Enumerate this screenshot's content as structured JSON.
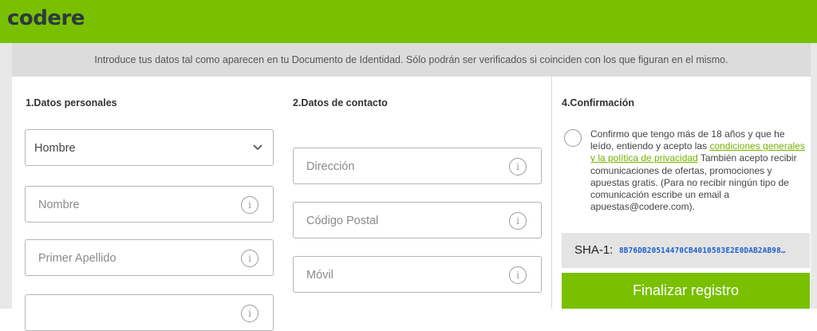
{
  "header": {
    "logo": "codere"
  },
  "notice": "Introduce tus datos tal como aparecen en tu Documento de Identidad. Sólo podrán ser verificados si coinciden con los que figuran en el mismo.",
  "sections": {
    "personal": {
      "title": "1.Datos personales",
      "gender_value": "Hombre",
      "nombre_placeholder": "Nombre",
      "apellido_placeholder": "Primer Apellido"
    },
    "contact": {
      "title": "2.Datos de contacto",
      "direccion_placeholder": "Dirección",
      "postal_placeholder": "Código Postal",
      "movil_placeholder": "Móvil"
    },
    "confirm": {
      "title": "4.Confirmación",
      "consent_before": "Confirmo que tengo más de 18 años y que he leído, entiendo y acepto las ",
      "consent_link": "condiciones generales y la política de privacidad",
      "consent_after": " También acepto recibir comunicaciones de ofertas, promociones y apuestas gratis. (Para no recibir ningún tipo de comunicación escribe un email a apuestas@codere.com).",
      "sha_label": "SHA-1:",
      "sha_value": "8B76DB20514470CB4010583E2E0DAB2AB98…",
      "submit_label": "Finalizar registro"
    }
  },
  "icons": {
    "info": "i",
    "chevron": "chevron-down-icon"
  },
  "colors": {
    "brand": "#79c000",
    "link": "#79b000",
    "sha": "#1a5fc8"
  }
}
